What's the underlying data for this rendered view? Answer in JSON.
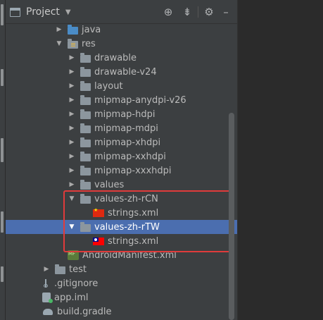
{
  "panel": {
    "title": "Project",
    "icons": {
      "view_selector": "project-view-icon",
      "dropdown": "chevron-down-icon",
      "locate": "crosshair-icon",
      "collapse": "collapse-all-icon",
      "settings": "gear-icon",
      "hide": "minimize-icon"
    }
  },
  "tree": [
    {
      "label": "java",
      "depth": 4,
      "expanded": false,
      "icon": "folder-blue-icon",
      "selected": false
    },
    {
      "label": "res",
      "depth": 4,
      "expanded": true,
      "icon": "resource-folder-icon",
      "selected": false
    },
    {
      "label": "drawable",
      "depth": 5,
      "expanded": false,
      "icon": "folder-icon",
      "selected": false
    },
    {
      "label": "drawable-v24",
      "depth": 5,
      "expanded": false,
      "icon": "folder-icon",
      "selected": false
    },
    {
      "label": "layout",
      "depth": 5,
      "expanded": false,
      "icon": "folder-icon",
      "selected": false
    },
    {
      "label": "mipmap-anydpi-v26",
      "depth": 5,
      "expanded": false,
      "icon": "folder-icon",
      "selected": false
    },
    {
      "label": "mipmap-hdpi",
      "depth": 5,
      "expanded": false,
      "icon": "folder-icon",
      "selected": false
    },
    {
      "label": "mipmap-mdpi",
      "depth": 5,
      "expanded": false,
      "icon": "folder-icon",
      "selected": false
    },
    {
      "label": "mipmap-xhdpi",
      "depth": 5,
      "expanded": false,
      "icon": "folder-icon",
      "selected": false
    },
    {
      "label": "mipmap-xxhdpi",
      "depth": 5,
      "expanded": false,
      "icon": "folder-icon",
      "selected": false
    },
    {
      "label": "mipmap-xxxhdpi",
      "depth": 5,
      "expanded": false,
      "icon": "folder-icon",
      "selected": false
    },
    {
      "label": "values",
      "depth": 5,
      "expanded": false,
      "icon": "folder-icon",
      "selected": false
    },
    {
      "label": "values-zh-rCN",
      "depth": 5,
      "expanded": true,
      "icon": "folder-icon",
      "selected": false
    },
    {
      "label": "strings.xml",
      "depth": 6,
      "expanded": null,
      "icon": "china-flag-icon",
      "selected": false
    },
    {
      "label": "values-zh-rTW",
      "depth": 5,
      "expanded": true,
      "icon": "folder-icon",
      "selected": true
    },
    {
      "label": "strings.xml",
      "depth": 6,
      "expanded": null,
      "icon": "taiwan-flag-icon",
      "selected": false
    },
    {
      "label": "AndroidManifest.xml",
      "depth": 4,
      "expanded": null,
      "icon": "manifest-icon",
      "selected": false
    },
    {
      "label": "test",
      "depth": 3,
      "expanded": false,
      "icon": "folder-icon",
      "selected": false
    },
    {
      "label": ".gitignore",
      "depth": 2,
      "expanded": null,
      "icon": "git-icon",
      "selected": false
    },
    {
      "label": "app.iml",
      "depth": 2,
      "expanded": null,
      "icon": "iml-icon",
      "selected": false
    },
    {
      "label": "build.gradle",
      "depth": 2,
      "expanded": null,
      "icon": "gradle-icon",
      "selected": false
    }
  ],
  "colors": {
    "selection": "#4b6eaf",
    "highlight_box": "#e03b3b",
    "panel_bg": "#3c3f41",
    "editor_bg": "#2b2b2b"
  }
}
